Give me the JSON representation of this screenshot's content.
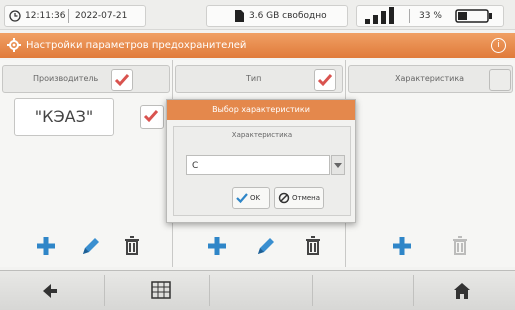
{
  "status": {
    "time": "12:11:36",
    "date": "2022-07-21",
    "storage": "3.6 GB свободно",
    "battery": "33 %"
  },
  "titlebar": {
    "title": "Настройки параметров предохранителей"
  },
  "columns": [
    {
      "header": "Производитель",
      "checked": true,
      "value": "\"КЭАЗ\""
    },
    {
      "header": "Тип",
      "checked": true,
      "value": ""
    },
    {
      "header": "Характеристика",
      "checked": false,
      "value": ""
    }
  ],
  "dialog": {
    "title": "Выбор характеристики",
    "field_label": "Характеристика",
    "selected_value": "C",
    "ok_label": "OK",
    "cancel_label": "Отмена"
  },
  "colors": {
    "accent": "#e07a3a",
    "check": "#d9534f",
    "add": "#2f86c8",
    "edit": "#3a8fd0"
  },
  "icons": [
    "back-icon",
    "calendar-grid-icon",
    "home-icon",
    "plus-icon",
    "pencil-icon",
    "trash-icon",
    "gear-icon",
    "info-icon",
    "clock-icon",
    "sd-card-icon",
    "signal-icon",
    "battery-icon"
  ]
}
